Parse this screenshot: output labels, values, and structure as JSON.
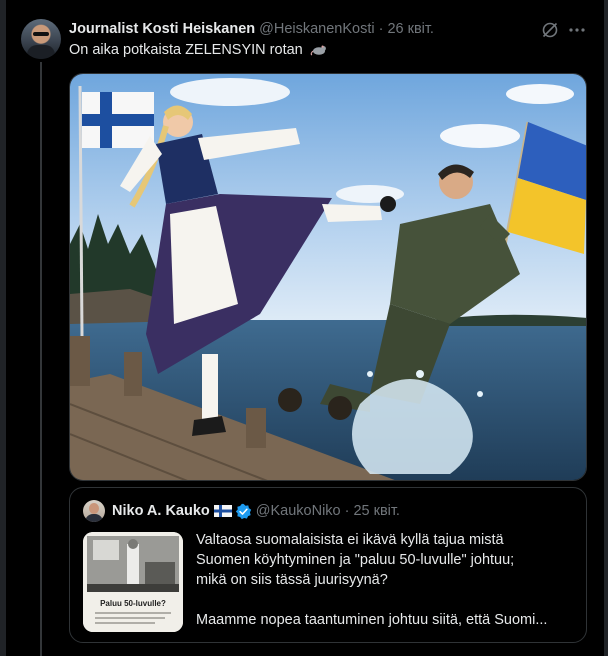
{
  "tweet": {
    "display_name": "Journalist Kosti Heiskanen",
    "handle": "@HeiskanenKosti",
    "separator": "·",
    "time": "26 квіт.",
    "text": "On aika potkaista ZELENSYIN rotan",
    "emoji": "rat-emoji",
    "media_icon_names": [
      "grok-icon",
      "more-icon"
    ]
  },
  "quote": {
    "display_name": "Niko A. Kauko",
    "flag": "finland-flag-icon",
    "verified": "verified-badge-icon",
    "handle": "@KaukoNiko",
    "separator": "·",
    "time": "25 квіт.",
    "lines": [
      "Valtaosa suomalaisista ei ikävä kyllä tajua mistä",
      "Suomen köyhtyminen ja \"paluu 50-luvulle\" johtuu;",
      "mikä on siis tässä juurisyynä?"
    ],
    "last_line": "Maamme nopea taantuminen johtuu siitä, että Suomi...",
    "thumbnail_caption": "Paluu 50-luvulle?"
  },
  "colors": {
    "background": "#000000",
    "text": "#e7e9ea",
    "muted": "#71767b",
    "border": "#2f3336",
    "verified": "#1d9bf0"
  }
}
